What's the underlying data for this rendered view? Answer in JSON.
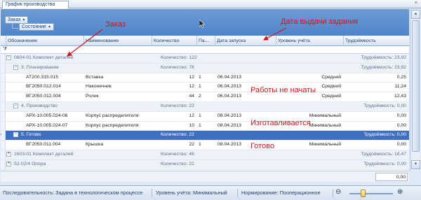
{
  "window": {
    "tab_title": "График производства",
    "close_glyph": "×"
  },
  "group_panel": {
    "chips": [
      {
        "label": "Заказ",
        "arrow": "▲"
      },
      {
        "label": "Состояние",
        "arrow": "▲"
      }
    ]
  },
  "columns": [
    "Обозначение",
    "Наименование",
    "Количество",
    "Па...",
    "Дата запуска",
    "Уровень учёта",
    "Трудоёмкость"
  ],
  "rows": [
    {
      "kind": "group",
      "level": 0,
      "expander": "⊟",
      "text": "0604-01 Комплект деталей",
      "qty": "Количество: 122",
      "labor": "Трудоёмкость: 23,92"
    },
    {
      "kind": "group",
      "level": 1,
      "expander": "⊟",
      "text": "3. Планирование",
      "qty": "Количество: 78",
      "labor": "Трудоёмкость: 23,92"
    },
    {
      "kind": "data",
      "code": "AT200.315.015",
      "name": "Вставка",
      "qty": "12",
      "part": "1",
      "date": "06.04.2013",
      "level_text": "Средний",
      "labor": "0,25"
    },
    {
      "kind": "data",
      "code": "ВГ2050.012.014",
      "name": "Наконечник",
      "qty": "12",
      "part": "1",
      "date": "06.04.2013",
      "level_text": "Средний",
      "labor": "11,24"
    },
    {
      "kind": "data",
      "code": "ВГ2050.012.004",
      "name": "Ролик",
      "qty": "44",
      "part": "2",
      "date": "06.04.2013",
      "level_text": "Средний",
      "labor": "12,43"
    },
    {
      "kind": "group",
      "level": 1,
      "expander": "⊟",
      "text": "4. Производство",
      "qty": "Количество: 22",
      "labor": "Трудоёмкость: 0,00"
    },
    {
      "kind": "data",
      "code": "АРХ-10.005.024-06",
      "name": "Корпус распределителя",
      "qty": "12",
      "part": "1",
      "date": "08.04.2013",
      "level_text": "Минимальный",
      "labor": "0,00"
    },
    {
      "kind": "data",
      "code": "АРХ-10.005.024-07",
      "name": "Корпус распределителя",
      "qty": "10",
      "part": "1",
      "date": "08.04.2013",
      "level_text": "Минимальный",
      "labor": "0,00"
    },
    {
      "kind": "group",
      "level": 1,
      "expander": "⊟",
      "text": "5. Готово",
      "qty": "Количество: 22",
      "labor": "Трудоёмкость: 0,00",
      "selected": true
    },
    {
      "kind": "data",
      "code": "ВГ2050.011.004",
      "name": "Крышка",
      "qty": "22",
      "part": "1",
      "date": "08.04.2013",
      "level_text": "Минимальный",
      "labor": "0,00"
    },
    {
      "kind": "group",
      "level": 0,
      "expander": "⊞",
      "text": "1603-01 Комплект деталей",
      "qty": "Количество: 46",
      "labor": "Трудоёмкость: 18,47"
    },
    {
      "kind": "group",
      "level": 0,
      "expander": "⊞",
      "text": "52-02/4 Опора",
      "qty": "Количество: 22",
      "labor": "Трудоёмкость: 0,00"
    }
  ],
  "footer_total": "0,00",
  "status": {
    "sequence": "Последовательность: Задана в технологическом процессе",
    "level": "Уровень учёта: Минимальный",
    "norm": "Нормирование: Пооперационное",
    "zoom_minus": "⊖",
    "zoom_plus": "⊕"
  },
  "annotations": {
    "order": "Заказ",
    "issue_date": "Дата выдачи задания",
    "not_started": "Работы не начаты",
    "in_progress": "Изготавливается",
    "done": "Готово"
  },
  "colors": {
    "annotation": "#d4141c",
    "selected_row": "#3f6fc0",
    "group_band": "#4f84c9"
  }
}
